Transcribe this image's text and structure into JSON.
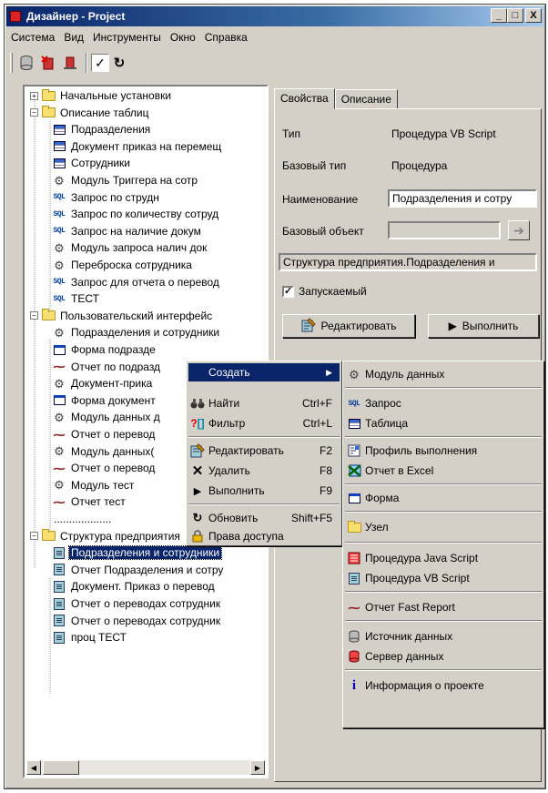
{
  "window": {
    "title": "Дизайнер - Project",
    "min": "_",
    "max": "□",
    "close": "X"
  },
  "menubar": [
    "Система",
    "Вид",
    "Инструменты",
    "Окно",
    "Справка"
  ],
  "tree": {
    "items": [
      {
        "label": "Начальные установки",
        "icon": "folder-icon"
      },
      {
        "label": "Описание таблиц",
        "icon": "folder-icon"
      },
      {
        "label": "Подразделения",
        "icon": "table-icon"
      },
      {
        "label": "Документ приказ на перемещ",
        "icon": "table-icon"
      },
      {
        "label": "Сотрудники",
        "icon": "table-icon"
      },
      {
        "label": "Модуль Триггера на сотр",
        "icon": "gear-icon"
      },
      {
        "label": "Запрос по струдн",
        "icon": "sql-icon"
      },
      {
        "label": "Запрос по количеству сотруд",
        "icon": "sql-icon"
      },
      {
        "label": "Запрос на наличие докум",
        "icon": "sql-icon"
      },
      {
        "label": "Модуль запроса налич док",
        "icon": "gear-icon"
      },
      {
        "label": "Переброска сотрудника",
        "icon": "gear-icon"
      },
      {
        "label": "Запрос для отчета о перевод",
        "icon": "sql-icon"
      },
      {
        "label": "ТЕСТ",
        "icon": "sql-icon"
      },
      {
        "label": "Пользовательский интерфейс",
        "icon": "folder-icon"
      },
      {
        "label": "Подразделения и сотрудники",
        "icon": "gear-icon"
      },
      {
        "label": "Форма подразде",
        "icon": "form-icon"
      },
      {
        "label": "Отчет по подразд",
        "icon": "report-icon"
      },
      {
        "label": "Документ-прика",
        "icon": "gear-icon"
      },
      {
        "label": "Форма документ",
        "icon": "form-icon"
      },
      {
        "label": "Модуль данных д",
        "icon": "gear-icon"
      },
      {
        "label": "Отчет о перевод",
        "icon": "report-icon"
      },
      {
        "label": "Модуль данных(",
        "icon": "gear-icon"
      },
      {
        "label": "Отчет о перевод",
        "icon": "report-icon"
      },
      {
        "label": "Модуль тест",
        "icon": "gear-icon"
      },
      {
        "label": "Отчет тест",
        "icon": "report-icon"
      },
      {
        "label": "...................",
        "icon": "none"
      },
      {
        "label": "Структура предприятия",
        "icon": "folder-icon"
      },
      {
        "label": "Подразделения и сотрудники",
        "icon": "script-icon"
      },
      {
        "label": "Отчет Подразделения и сотру",
        "icon": "script-icon"
      },
      {
        "label": "Документ. Приказ о перевод",
        "icon": "script-icon"
      },
      {
        "label": "Отчет о переводах сотрудник",
        "icon": "script-icon"
      },
      {
        "label": "Отчет о переводах сотрудник",
        "icon": "script-icon"
      },
      {
        "label": "проц ТЕСТ",
        "icon": "script-icon"
      }
    ]
  },
  "tabs": [
    "Свойства",
    "Описание"
  ],
  "properties": {
    "type_label": "Тип",
    "type_value": "Процедура VB Script",
    "base_type_label": "Базовый тип",
    "base_type_value": "Процедура",
    "name_label": "Наименование",
    "name_value": "Подразделения и сотру",
    "base_object_label": "Базовый объект",
    "base_object_value": "",
    "path_value": "Структура предприятия.Подразделения и",
    "launchable_label": "Запускаемый",
    "launchable_checked": true,
    "edit_button": "Редактировать",
    "run_button": "Выполнить"
  },
  "context_menu": {
    "items": [
      {
        "label": "Создать",
        "shortcut": "",
        "icon": "none",
        "submenu": true
      },
      {
        "label": "Найти",
        "shortcut": "Ctrl+F",
        "icon": "binoculars-icon"
      },
      {
        "label": "Фильтр",
        "shortcut": "Ctrl+L",
        "icon": "filter-icon"
      },
      {
        "label": "Редактировать",
        "shortcut": "F2",
        "icon": "edit-icon"
      },
      {
        "label": "Удалить",
        "shortcut": "F8",
        "icon": "delete-icon"
      },
      {
        "label": "Выполнить",
        "shortcut": "F9",
        "icon": "play-icon"
      },
      {
        "label": "Обновить",
        "shortcut": "Shift+F5",
        "icon": "refresh-icon"
      },
      {
        "label": "Права доступа",
        "shortcut": "",
        "icon": "lock-icon"
      }
    ]
  },
  "submenu": {
    "items": [
      {
        "label": "Модуль данных",
        "icon": "gear-icon"
      },
      {
        "label": "Запрос",
        "icon": "sql-icon"
      },
      {
        "label": "Таблица",
        "icon": "table-icon"
      },
      {
        "label": "Профиль выполнения",
        "icon": "profile-icon"
      },
      {
        "label": "Отчет в Excel",
        "icon": "excel-icon"
      },
      {
        "label": "Форма",
        "icon": "form-icon"
      },
      {
        "label": "Узел",
        "icon": "folder-icon"
      },
      {
        "label": "Процедура Java Script",
        "icon": "js-icon"
      },
      {
        "label": "Процедура VB Script",
        "icon": "script-icon"
      },
      {
        "label": "Отчет Fast Report",
        "icon": "report-icon"
      },
      {
        "label": "Источник данных",
        "icon": "datasource-icon"
      },
      {
        "label": "Сервер данных",
        "icon": "server-icon"
      },
      {
        "label": "Информация о проекте",
        "icon": "info-icon"
      }
    ]
  },
  "icons": {
    "sql_text": "SQL",
    "check": "✓",
    "arrow_right": "➔",
    "submenu_arrow": "▶",
    "play": "▶",
    "refresh": "↻"
  }
}
